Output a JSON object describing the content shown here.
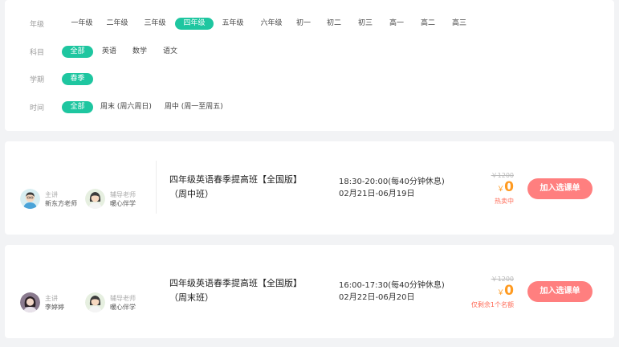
{
  "filters": {
    "grade": {
      "label": "年级",
      "options": [
        "一年级",
        "二年级",
        "三年级",
        "四年级",
        "五年级",
        "六年级",
        "初一",
        "初二",
        "初三",
        "高一",
        "高二",
        "高三"
      ],
      "selected": "四年级"
    },
    "subject": {
      "label": "科目",
      "options": [
        "全部",
        "英语",
        "数学",
        "语文"
      ],
      "selected": "全部"
    },
    "term": {
      "label": "学期",
      "options": [
        "春季"
      ],
      "selected": "春季"
    },
    "time": {
      "label": "时间",
      "options": [
        "全部",
        "周末 (周六周日)",
        "周中 (周一至周五)"
      ],
      "selected": "全部"
    }
  },
  "courses": [
    {
      "main_role": "主讲",
      "main_name": "新东方老师",
      "tutor_role": "辅导老师",
      "tutor_name": "暖心伴学",
      "title_line1": "四年级英语春季提高班【全国版】",
      "title_line2": "（周中班）",
      "time": "18:30-20:00(每40分钟休息)",
      "dates": "02月21日-06月19日",
      "original_price": "￥1200",
      "currency": "￥",
      "price": "0",
      "note": "热卖中",
      "button": "加入选课单"
    },
    {
      "main_role": "主讲",
      "main_name": "李婷婷",
      "tutor_role": "辅导老师",
      "tutor_name": "暖心伴学",
      "title_line1": "四年级英语春季提高班【全国版】",
      "title_line2": "（周末班）",
      "time": "16:00-17:30(每40分钟休息)",
      "dates": "02月22日-06月20日",
      "original_price": "￥1200",
      "currency": "￥",
      "price": "0",
      "note": "仅剩余1个名额",
      "button": "加入选课单"
    }
  ],
  "colors": {
    "accent": "#1ec6a0",
    "button": "#ff7f7f",
    "price": "#ff9a20",
    "note": "#ff6b57"
  },
  "icons": {
    "main_teacher_1": "teacher-avatar-boy-icon",
    "main_teacher_2": "teacher-photo-avatar",
    "tutor": "tutor-avatar-girl-icon"
  }
}
